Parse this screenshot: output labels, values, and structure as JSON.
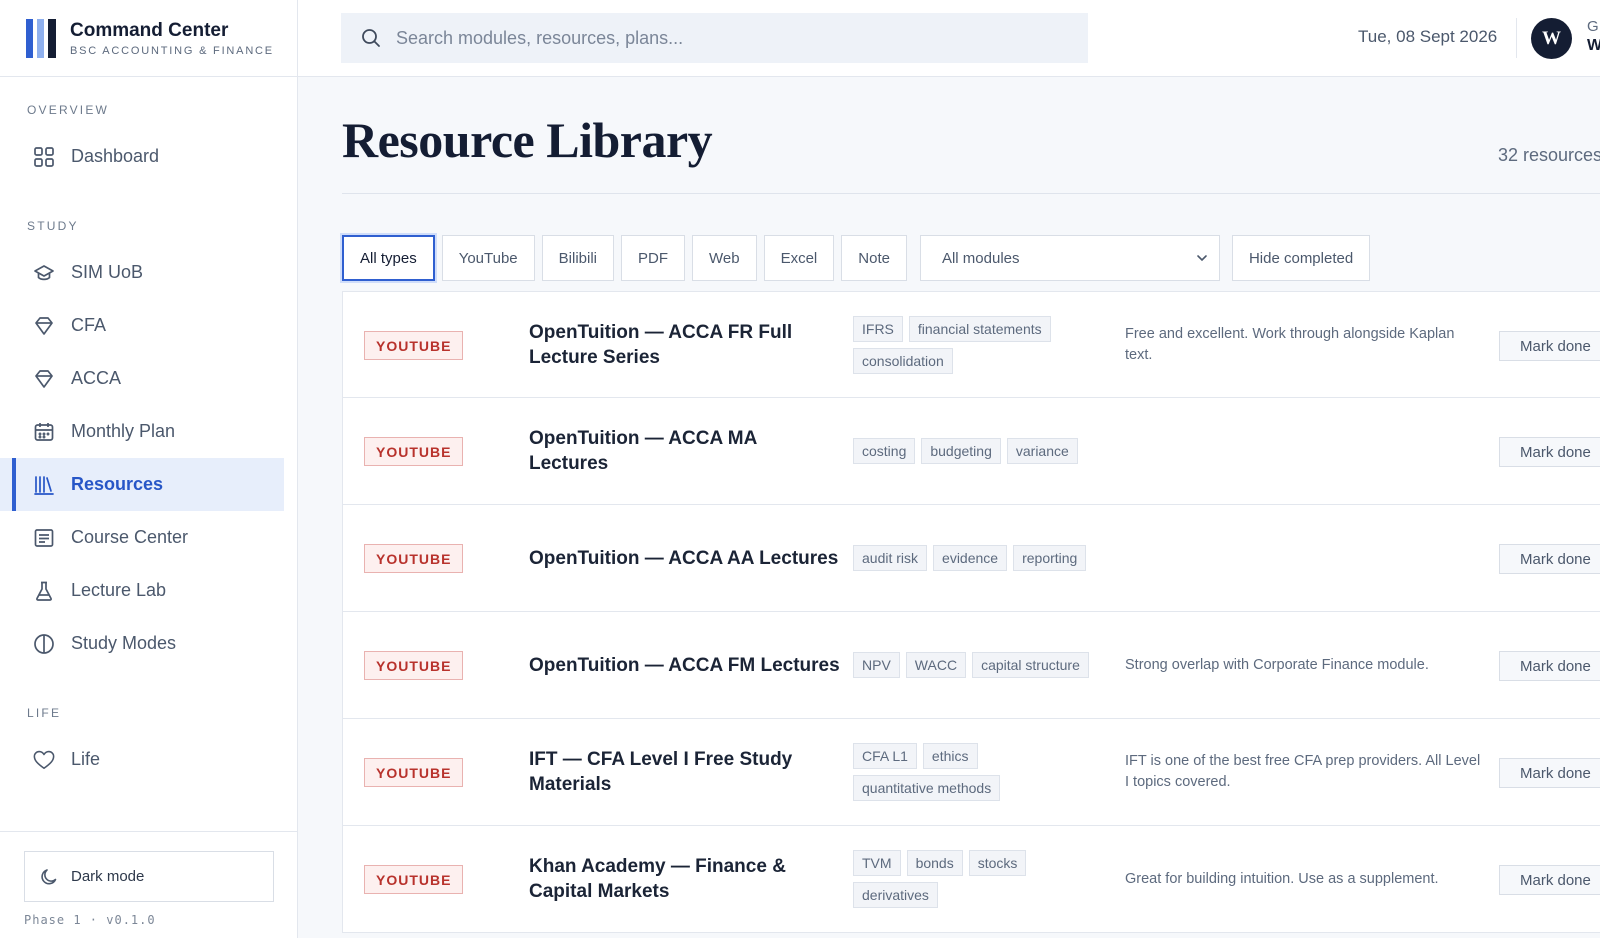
{
  "brand": {
    "title": "Command Center",
    "subtitle": "BSC ACCOUNTING & FINANCE"
  },
  "search": {
    "placeholder": "Search modules, resources, plans..."
  },
  "header": {
    "date": "Tue, 08 Sept 2026",
    "avatar_initial": "W",
    "user_line1": "G",
    "user_line2": "W"
  },
  "sidebar": {
    "sections": [
      {
        "label": "OVERVIEW",
        "items": [
          {
            "label": "Dashboard",
            "icon": "grid-icon"
          }
        ]
      },
      {
        "label": "STUDY",
        "items": [
          {
            "label": "SIM UoB",
            "icon": "graduation-cap-icon"
          },
          {
            "label": "CFA",
            "icon": "diamond-icon"
          },
          {
            "label": "ACCA",
            "icon": "diamond-icon"
          },
          {
            "label": "Monthly Plan",
            "icon": "calendar-icon"
          },
          {
            "label": "Resources",
            "icon": "library-icon",
            "active": true
          },
          {
            "label": "Course Center",
            "icon": "document-list-icon"
          },
          {
            "label": "Lecture Lab",
            "icon": "flask-icon"
          },
          {
            "label": "Study Modes",
            "icon": "half-circle-icon"
          }
        ]
      },
      {
        "label": "LIFE",
        "items": [
          {
            "label": "Life",
            "icon": "heart-icon"
          }
        ]
      }
    ],
    "dark_mode_label": "Dark mode",
    "version": "Phase 1 · v0.1.0"
  },
  "page": {
    "title": "Resource Library",
    "count": "32 resources"
  },
  "filters": {
    "types": [
      "All types",
      "YouTube",
      "Bilibili",
      "PDF",
      "Web",
      "Excel",
      "Note"
    ],
    "active_type": "All types",
    "module_select": "All modules",
    "hide_completed": "Hide completed"
  },
  "resources": [
    {
      "type": "YOUTUBE",
      "title": "OpenTuition — ACCA FR Full Lecture Series",
      "tags": [
        "IFRS",
        "financial statements",
        "consolidation"
      ],
      "note": "Free and excellent. Work through alongside Kaplan text.",
      "action": "Mark done"
    },
    {
      "type": "YOUTUBE",
      "title": "OpenTuition — ACCA MA Lectures",
      "tags": [
        "costing",
        "budgeting",
        "variance"
      ],
      "note": "",
      "action": "Mark done"
    },
    {
      "type": "YOUTUBE",
      "title": "OpenTuition — ACCA AA Lectures",
      "tags": [
        "audit risk",
        "evidence",
        "reporting"
      ],
      "note": "",
      "action": "Mark done"
    },
    {
      "type": "YOUTUBE",
      "title": "OpenTuition — ACCA FM Lectures",
      "tags": [
        "NPV",
        "WACC",
        "capital structure"
      ],
      "note": "Strong overlap with Corporate Finance module.",
      "action": "Mark done"
    },
    {
      "type": "YOUTUBE",
      "title": "IFT — CFA Level I Free Study Materials",
      "tags": [
        "CFA L1",
        "ethics",
        "quantitative methods"
      ],
      "note": "IFT is one of the best free CFA prep providers. All Level I topics covered.",
      "action": "Mark done"
    },
    {
      "type": "YOUTUBE",
      "title": "Khan Academy — Finance & Capital Markets",
      "tags": [
        "TVM",
        "bonds",
        "stocks",
        "derivatives"
      ],
      "note": "Great for building intuition. Use as a supplement.",
      "action": "Mark done"
    }
  ],
  "colors": {
    "accent": "#2f5fd0",
    "youtube_badge": "#b8322c",
    "ink": "#141d33"
  }
}
